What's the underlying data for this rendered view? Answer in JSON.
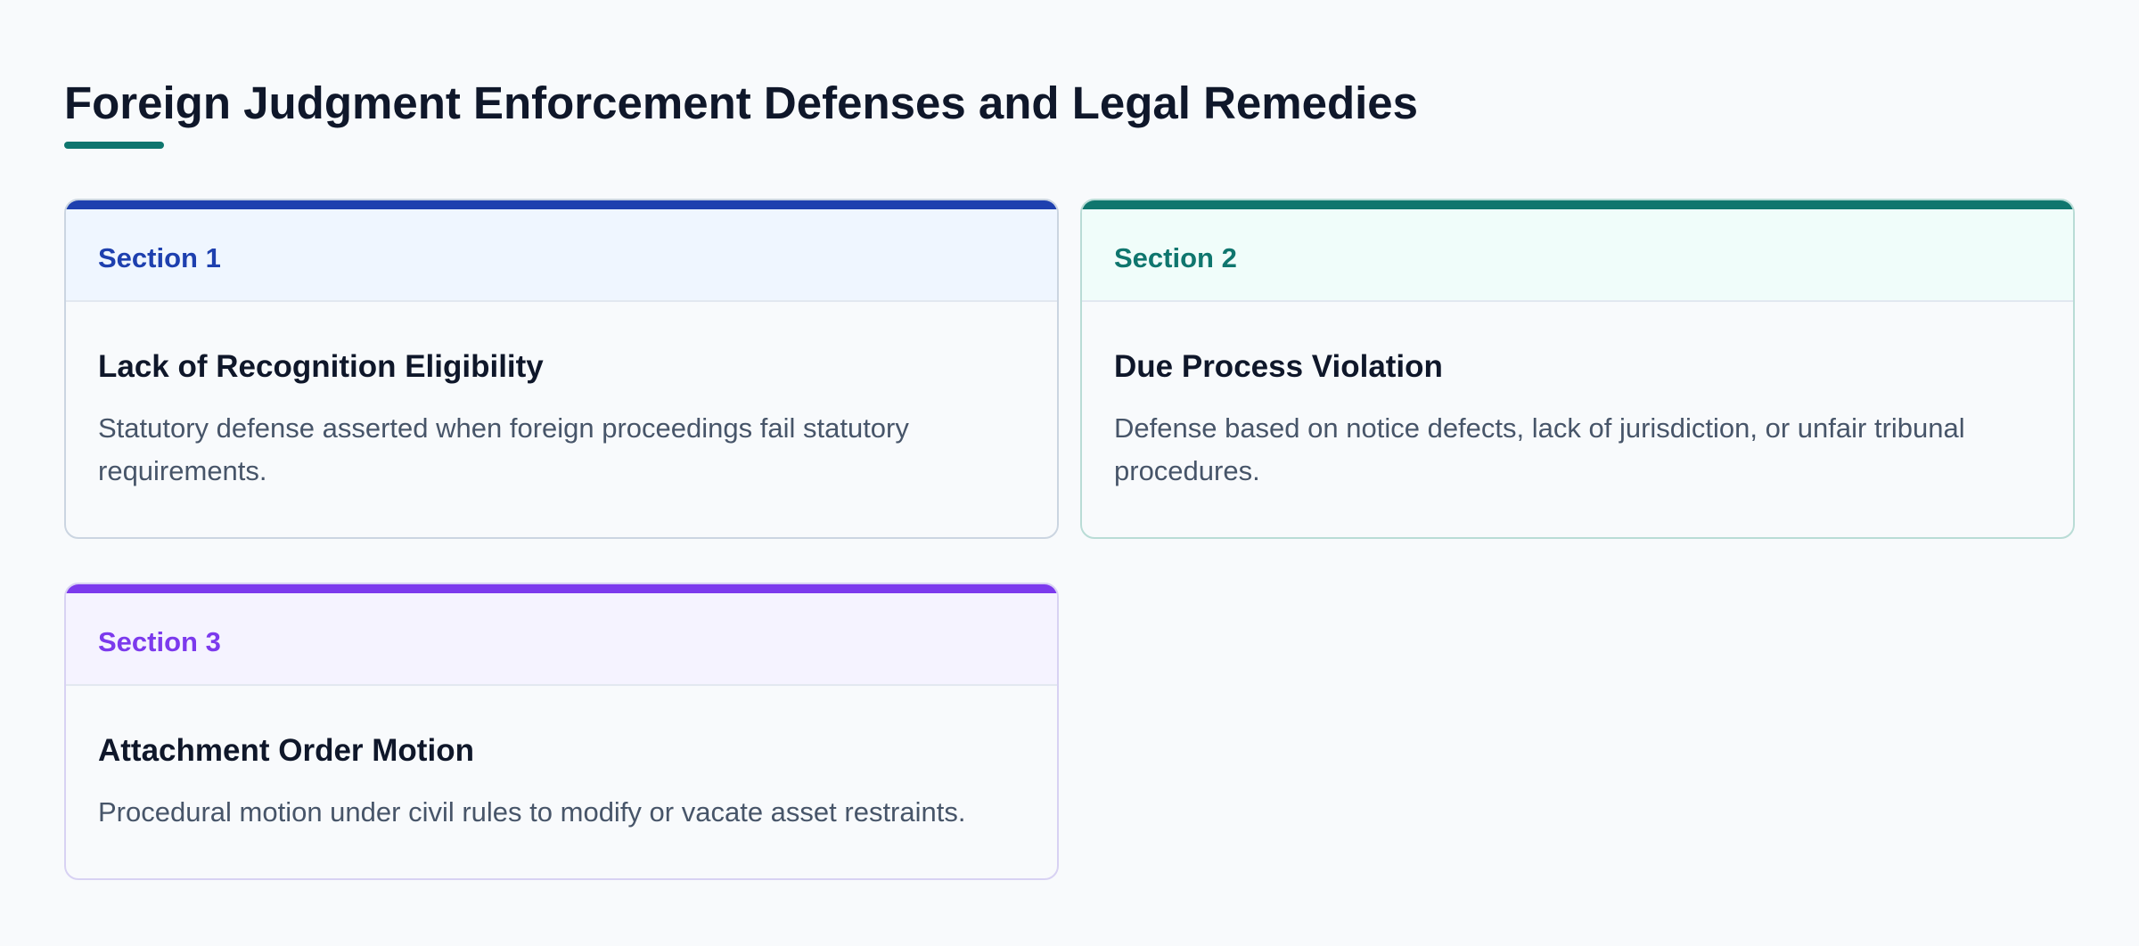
{
  "page": {
    "title": "Foreign Judgment Enforcement Defenses and Legal Remedies",
    "accent_color": "#0f766e"
  },
  "cards": [
    {
      "section_label": "Section 1",
      "title": "Lack of Recognition Eligibility",
      "description": "Statutory defense asserted when foreign proceedings fail statutory requirements.",
      "accent_color": "#1e40af"
    },
    {
      "section_label": "Section 2",
      "title": "Due Process Violation",
      "description": "Defense based on notice defects, lack of jurisdiction, or unfair tribunal procedures.",
      "accent_color": "#0f766e"
    },
    {
      "section_label": "Section 3",
      "title": "Attachment Order Motion",
      "description": "Procedural motion under civil rules to modify or vacate asset restraints.",
      "accent_color": "#7c3aed"
    }
  ]
}
